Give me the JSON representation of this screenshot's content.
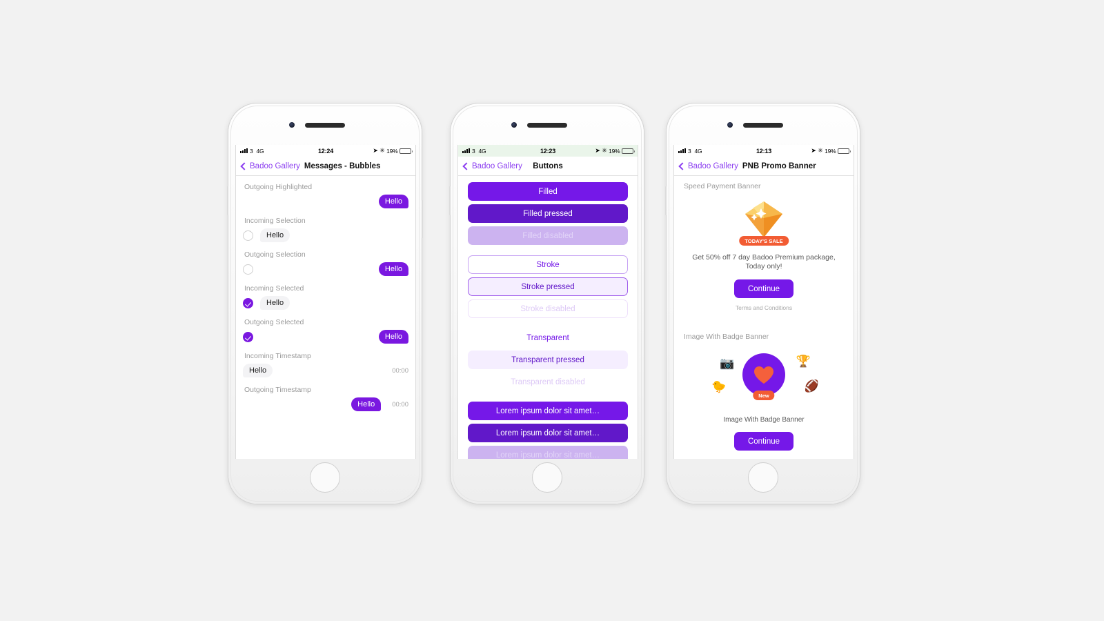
{
  "page": {
    "background": "#f2f2f2",
    "accent": "#7518e8",
    "accent_dark": "#6118c9",
    "orange": "#f25c33"
  },
  "phones": [
    {
      "id": "messages",
      "status": {
        "signal": "3",
        "carrier": "4G",
        "time": "12:24",
        "battery_percent": "19%",
        "tinted": false
      },
      "nav": {
        "back_label": "Badoo Gallery",
        "title": "Messages - Bubbles",
        "title_centered": false
      },
      "sections": [
        {
          "label": "Outgoing Highlighted",
          "rows": [
            {
              "type": "out-bubble",
              "text": "Hello"
            }
          ]
        },
        {
          "label": "Incoming Selection",
          "rows": [
            {
              "type": "in-select",
              "checked": false,
              "text": "Hello"
            }
          ]
        },
        {
          "label": "Outgoing Selection",
          "rows": [
            {
              "type": "out-select",
              "checked": false,
              "text": "Hello"
            }
          ]
        },
        {
          "label": "Incoming Selected",
          "rows": [
            {
              "type": "in-select",
              "checked": true,
              "text": "Hello"
            }
          ]
        },
        {
          "label": "Outgoing Selected",
          "rows": [
            {
              "type": "out-select",
              "checked": true,
              "text": "Hello"
            }
          ]
        },
        {
          "label": "Incoming Timestamp",
          "rows": [
            {
              "type": "in-ts",
              "text": "Hello",
              "time": "00:00"
            }
          ]
        },
        {
          "label": "Outgoing Timestamp",
          "rows": [
            {
              "type": "out-ts",
              "text": "Hello",
              "time": "00:00"
            }
          ]
        }
      ]
    },
    {
      "id": "buttons",
      "status": {
        "signal": "3",
        "carrier": "4G",
        "time": "12:23",
        "battery_percent": "19%",
        "tinted": true
      },
      "nav": {
        "back_label": "Badoo Gallery",
        "title": "Buttons",
        "title_centered": true
      },
      "buttons": [
        {
          "label": "Filled",
          "style": "filled"
        },
        {
          "label": "Filled pressed",
          "style": "filled-pressed"
        },
        {
          "label": "Filled disabled",
          "style": "filled-disabled"
        },
        {
          "label": "Stroke",
          "style": "stroke"
        },
        {
          "label": "Stroke pressed",
          "style": "stroke-pressed"
        },
        {
          "label": "Stroke disabled",
          "style": "stroke-disabled"
        },
        {
          "label": "Transparent",
          "style": "transparent"
        },
        {
          "label": "Transparent pressed",
          "style": "transparent-pressed"
        },
        {
          "label": "Transparent disabled",
          "style": "transparent-disabled"
        },
        {
          "label": "Lorem ipsum dolor sit amet…",
          "style": "filled"
        },
        {
          "label": "Lorem ipsum dolor sit amet…",
          "style": "filled-pressed"
        },
        {
          "label": "Lorem ipsum dolor sit amet…",
          "style": "filled-disabled"
        }
      ]
    },
    {
      "id": "promo",
      "status": {
        "signal": "3",
        "carrier": "4G",
        "time": "12:13",
        "battery_percent": "19%",
        "tinted": false
      },
      "nav": {
        "back_label": "Badoo Gallery",
        "title": "PNB Promo Banner",
        "title_centered": false
      },
      "speed_payment": {
        "section_label": "Speed Payment Banner",
        "sale_badge": "TODAY'S SALE",
        "promo_text": "Get 50% off 7 day Badoo Premium package, Today only!",
        "cta_label": "Continue",
        "terms_label": "Terms and Conditions",
        "art_icon": "gem-icon"
      },
      "image_badge": {
        "section_label": "Image With Badge Banner",
        "new_badge": "New",
        "caption": "Image With Badge Banner",
        "cta_label": "Continue",
        "emojis": [
          "camera-icon",
          "duck-icon",
          "trophy-icon",
          "football-icon",
          "heart-icon"
        ]
      }
    }
  ]
}
